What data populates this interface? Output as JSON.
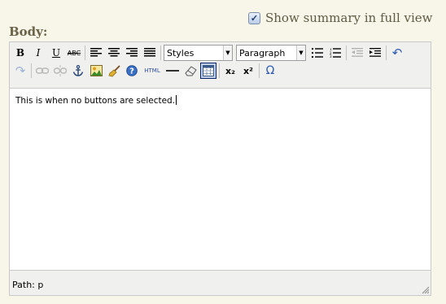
{
  "summary": {
    "label": "Show summary in full view",
    "checked": true
  },
  "body_label": "Body:",
  "toolbar": {
    "bold": "B",
    "italic": "I",
    "underline": "U",
    "strikethrough": "ABC",
    "styles_select": "Styles",
    "format_select": "Paragraph",
    "html": "HTML",
    "subscript": "x₂",
    "superscript": "x²",
    "omega": "Ω",
    "undo": "↶",
    "redo": "↷"
  },
  "content": {
    "text": "This is when no buttons are selected."
  },
  "statusbar": {
    "path": "Path: p"
  }
}
